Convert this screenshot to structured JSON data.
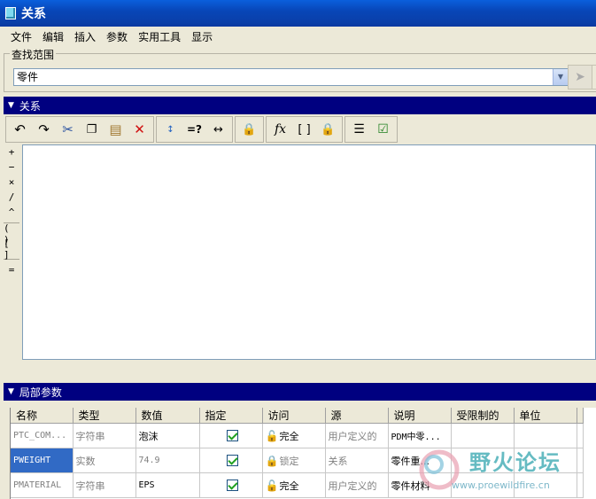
{
  "window": {
    "title": "关系"
  },
  "menu": [
    "文件",
    "编辑",
    "插入",
    "参数",
    "实用工具",
    "显示"
  ],
  "lookup": {
    "legend": "查找范围",
    "value": "零件"
  },
  "relations_panel": {
    "title": "关系"
  },
  "toolbar_icons": [
    "undo-icon",
    "redo-icon",
    "cut-icon",
    "copy-icon",
    "paste-icon",
    "delete-icon",
    "display-values-icon",
    "evaluate-icon",
    "insert-dimension-icon",
    "sort-icon",
    "function-icon",
    "bracket-icon",
    "verify-icon",
    "properties-icon",
    "check-icon"
  ],
  "toolbar_text": {
    "evaluate": "=?",
    "function": "fx",
    "bracket": "[ ]"
  },
  "side_operators": [
    "+",
    "−",
    "×",
    "/",
    "^",
    "( )",
    "[ ]",
    "="
  ],
  "local_params": {
    "title": "局部参数",
    "columns": [
      "名称",
      "类型",
      "数值",
      "指定",
      "访问",
      "源",
      "说明",
      "受限制的",
      "单位"
    ],
    "rows": [
      {
        "name": "PTC_COM...",
        "type": "字符串",
        "value": "泡沫",
        "designated": true,
        "access": "完全",
        "source": "用户定义的",
        "desc": "PDM中零...",
        "restricted": "",
        "unit": ""
      },
      {
        "name": "PWEIGHT",
        "type": "实数",
        "value": "74.9",
        "designated": true,
        "access": "锁定",
        "source": "关系",
        "desc": "零件重...",
        "restricted": "",
        "unit": ""
      },
      {
        "name": "PMATERIAL",
        "type": "字符串",
        "value": "EPS",
        "designated": true,
        "access": "完全",
        "source": "用户定义的",
        "desc": "零件材料",
        "restricted": "",
        "unit": ""
      }
    ]
  },
  "watermark": {
    "title": "野火论坛",
    "url": "www.proewildfire.cn"
  }
}
